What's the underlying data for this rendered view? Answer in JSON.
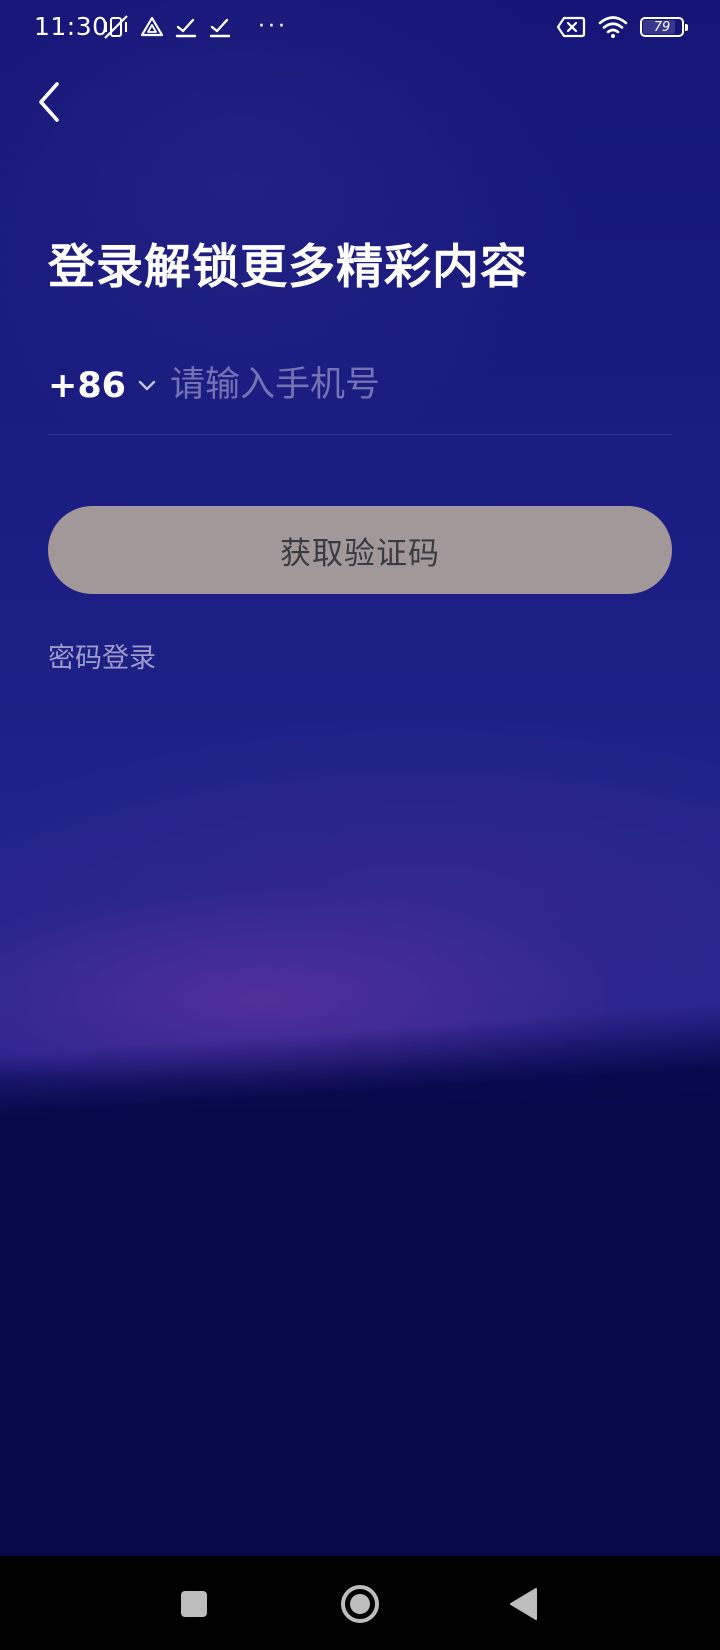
{
  "status_bar": {
    "time": "11:30",
    "left_icons": [
      "vibrate-off-icon",
      "drive-icon",
      "check-icon",
      "check-icon",
      "more-dots-icon"
    ],
    "more_dots": "···",
    "right_icons": [
      "sim-error-icon",
      "wifi-icon",
      "battery-icon"
    ],
    "battery_level": "79"
  },
  "header": {
    "back_icon": "chevron-left-icon"
  },
  "main": {
    "title": "登录解锁更多精彩内容",
    "country_code": "+86",
    "phone_placeholder": "请输入手机号",
    "phone_value": "",
    "get_code_button": "获取验证码",
    "password_login_link": "密码登录"
  },
  "colors": {
    "background_top": "#151577",
    "background_bottom": "#06084a",
    "button_background": "#a39899",
    "button_text": "#3a3a42",
    "link_text": "#c8c3e1"
  },
  "nav_bar": {
    "icons": [
      "recents-square-icon",
      "home-circle-icon",
      "back-triangle-icon"
    ]
  }
}
